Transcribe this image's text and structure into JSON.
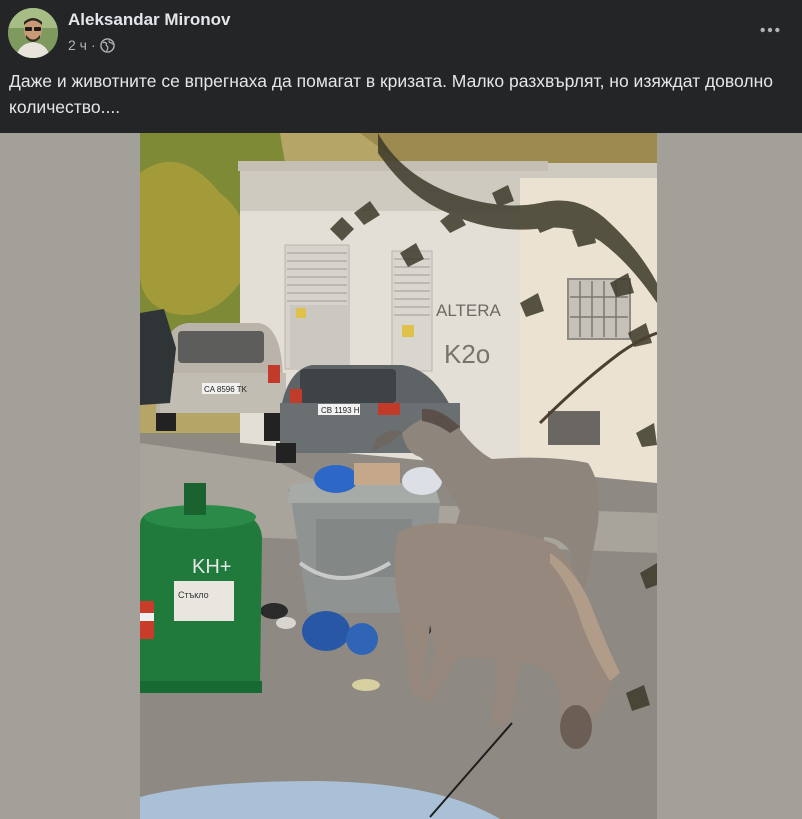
{
  "post": {
    "author_name": "Aleksandar Mironov",
    "time": "2 ч",
    "separator": "·",
    "audience_icon": "globe-icon",
    "more_icon": "more-horizontal-icon",
    "text": "Даже и животните се впрегнаха да помагат в кризата. Малко разхвърлят, но изяждат доволно количество...."
  },
  "photo": {
    "wall_graffiti": "ALTERA",
    "graffiti_2": "K2o",
    "bin_graffiti": "KH+",
    "bin_label": "Стъкло",
    "plate_1": "CA 8596 TK",
    "plate_2": "CB 1193 H"
  },
  "colors": {
    "background": "#242526",
    "media_background": "#a39f99",
    "text_primary": "#e4e6eb",
    "text_secondary": "#b0b3b8"
  }
}
